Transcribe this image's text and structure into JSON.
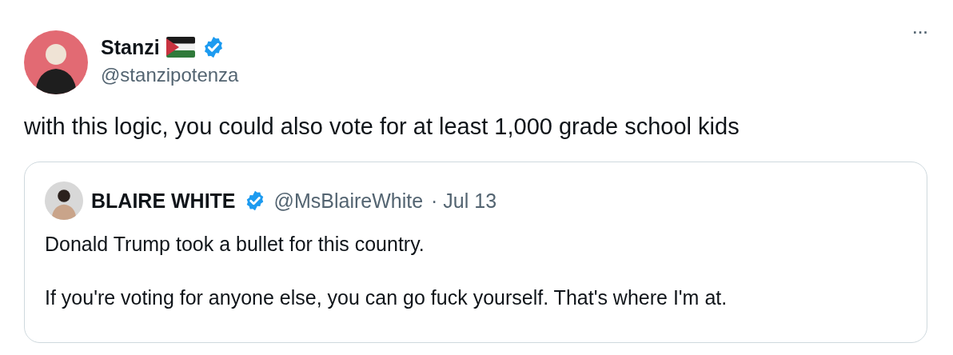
{
  "tweet": {
    "author": {
      "name": "Stanzi",
      "handle": "@stanzipotenza",
      "verified": true
    },
    "more": "···",
    "text": "with this logic, you could also vote for at least 1,000 grade school kids",
    "quote": {
      "author": {
        "name": "BLAIRE WHITE",
        "handle": "@MsBlaireWhite",
        "verified": true
      },
      "date": "· Jul 13",
      "paragraphs": [
        "Donald Trump took a bullet for this country.",
        "If you're voting for anyone else, you can go fuck yourself. That's where I'm at."
      ]
    }
  }
}
